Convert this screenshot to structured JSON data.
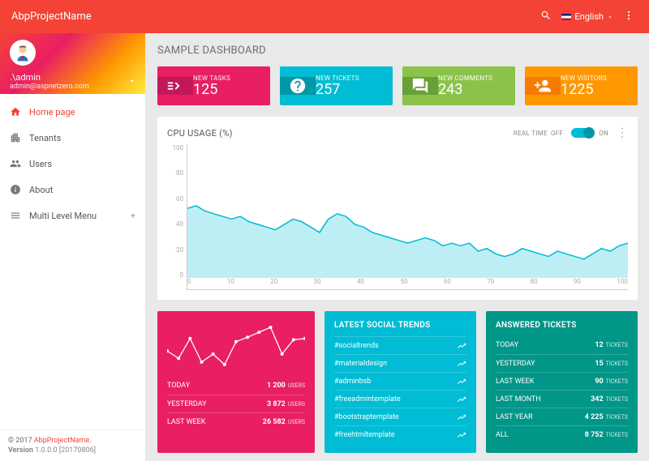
{
  "header": {
    "brand": "AbpProjectName",
    "language_label": "English"
  },
  "user": {
    "name": ".\\admin",
    "email": "admin@aspnetzero.com"
  },
  "nav": {
    "items": [
      {
        "icon": "home",
        "label": "Home page",
        "active": true
      },
      {
        "icon": "tenants",
        "label": "Tenants"
      },
      {
        "icon": "users",
        "label": "Users"
      },
      {
        "icon": "about",
        "label": "About"
      },
      {
        "icon": "multi",
        "label": "Multi Level Menu",
        "expandable": true
      }
    ]
  },
  "footer": {
    "copyright": "© 2017 ",
    "link": "AbpProjectName.",
    "version_label": "Version",
    "version_value": " 1.0.0.0 [20170806]"
  },
  "page": {
    "title": "SAMPLE DASHBOARD"
  },
  "cards": [
    {
      "color": "pink",
      "icon": "tasks",
      "label": "NEW TASKS",
      "value": "125"
    },
    {
      "color": "cyan",
      "icon": "help",
      "label": "NEW TICKETS",
      "value": "257"
    },
    {
      "color": "green",
      "icon": "comments",
      "label": "NEW COMMENTS",
      "value": "243"
    },
    {
      "color": "orange",
      "icon": "person-add",
      "label": "NEW VISITORS",
      "value": "1225"
    }
  ],
  "cpu": {
    "title": "CPU USAGE (%)",
    "realtime_label": "REAL TIME",
    "off_label": "OFF",
    "on_label": "ON",
    "toggle": true
  },
  "chart_data": {
    "type": "area",
    "title": "CPU USAGE (%)",
    "xlabel": "",
    "ylabel": "",
    "xlim": [
      0,
      100
    ],
    "ylim": [
      0,
      100
    ],
    "x_ticks": [
      "0",
      "10",
      "20",
      "30",
      "40",
      "50",
      "60",
      "70",
      "80",
      "90",
      "100"
    ],
    "y_ticks": [
      "0",
      "20",
      "40",
      "60",
      "80",
      "100"
    ],
    "x": [
      0,
      2,
      4,
      6,
      8,
      10,
      12,
      14,
      16,
      18,
      20,
      22,
      24,
      26,
      28,
      30,
      32,
      34,
      36,
      38,
      40,
      42,
      44,
      46,
      48,
      50,
      52,
      54,
      56,
      58,
      60,
      62,
      64,
      66,
      68,
      70,
      72,
      74,
      76,
      78,
      80,
      82,
      84,
      86,
      88,
      90,
      92,
      94,
      96,
      98,
      100
    ],
    "values": [
      52,
      54,
      50,
      48,
      46,
      44,
      46,
      42,
      40,
      38,
      36,
      40,
      44,
      42,
      38,
      34,
      44,
      48,
      46,
      40,
      38,
      34,
      32,
      30,
      28,
      26,
      28,
      30,
      28,
      24,
      26,
      24,
      26,
      20,
      22,
      18,
      16,
      18,
      22,
      20,
      18,
      16,
      20,
      18,
      16,
      14,
      18,
      22,
      20,
      24,
      26
    ]
  },
  "visits": {
    "spark_values": [
      40,
      28,
      60,
      22,
      35,
      18,
      55,
      62,
      70,
      78,
      35,
      58,
      60
    ],
    "rows": [
      {
        "k": "TODAY",
        "v": "1 200",
        "u": "USERS"
      },
      {
        "k": "YESTERDAY",
        "v": "3 872",
        "u": "USERS"
      },
      {
        "k": "LAST WEEK",
        "v": "26 582",
        "u": "USERS"
      }
    ]
  },
  "trends": {
    "title": "LATEST SOCIAL TRENDS",
    "items": [
      "#socialtrends",
      "#materialdesign",
      "#adminbsb",
      "#freeadmintemplate",
      "#bootstraptemplate",
      "#freehtmltemplate"
    ]
  },
  "tickets": {
    "title": "ANSWERED TICKETS",
    "rows": [
      {
        "k": "TODAY",
        "v": "12",
        "u": "TICKETS"
      },
      {
        "k": "YESTERDAY",
        "v": "15",
        "u": "TICKETS"
      },
      {
        "k": "LAST WEEK",
        "v": "90",
        "u": "TICKETS"
      },
      {
        "k": "LAST MONTH",
        "v": "342",
        "u": "TICKETS"
      },
      {
        "k": "LAST YEAR",
        "v": "4 225",
        "u": "TICKETS"
      },
      {
        "k": "ALL",
        "v": "8 752",
        "u": "TICKETS"
      }
    ]
  }
}
